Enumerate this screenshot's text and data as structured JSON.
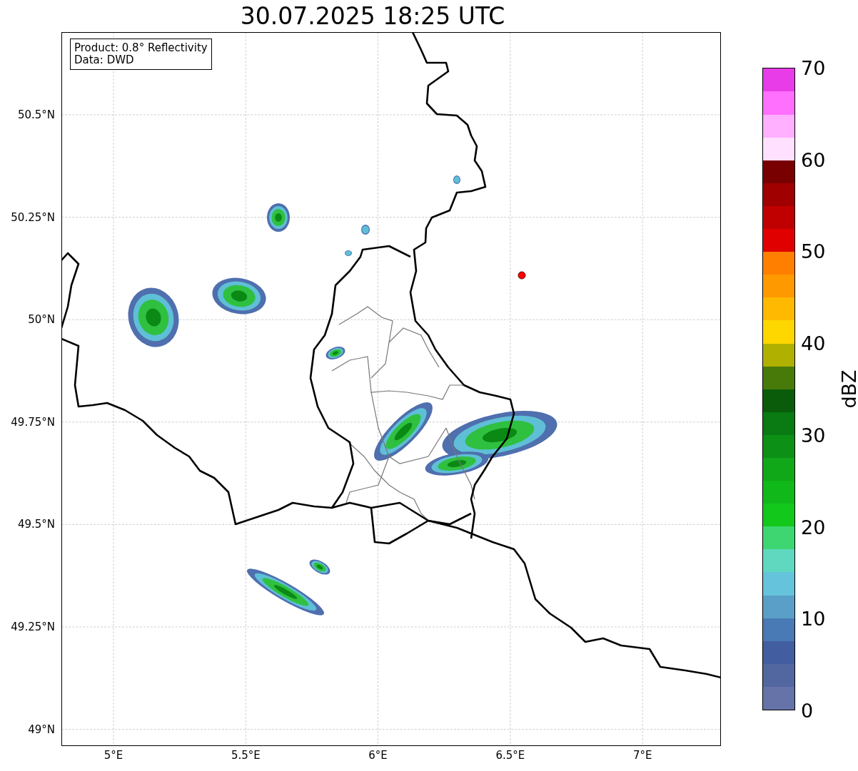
{
  "title": "30.07.2025 18:25 UTC",
  "legend": [
    "Product: 0.8° Reflectivity",
    "Data: DWD"
  ],
  "map": {
    "lat_ticks": [
      "50.5°N",
      "50.25°N",
      "50°N",
      "49.75°N",
      "49.5°N",
      "49.25°N",
      "49°N"
    ],
    "lon_ticks": [
      "5°E",
      "5.5°E",
      "6°E",
      "6.5°E",
      "7°E"
    ]
  },
  "colorbar": {
    "label": "dBZ",
    "ticks": [
      "70",
      "60",
      "50",
      "40",
      "30",
      "20",
      "10",
      "0"
    ],
    "bands": [
      {
        "color": "#6673a8"
      },
      {
        "color": "#5266a0"
      },
      {
        "color": "#425ea0"
      },
      {
        "color": "#4a7ab5"
      },
      {
        "color": "#5a9fc8"
      },
      {
        "color": "#65c3dc"
      },
      {
        "color": "#60d8c0"
      },
      {
        "color": "#3dd670"
      },
      {
        "color": "#12c81a"
      },
      {
        "color": "#10b81a"
      },
      {
        "color": "#10a818"
      },
      {
        "color": "#0c9015"
      },
      {
        "color": "#0a7a12"
      },
      {
        "color": "#0a5c0a"
      },
      {
        "color": "#487a0a"
      },
      {
        "color": "#b0b000"
      },
      {
        "color": "#ffd700"
      },
      {
        "color": "#ffb900"
      },
      {
        "color": "#ff9900"
      },
      {
        "color": "#ff7f00"
      },
      {
        "color": "#e00000"
      },
      {
        "color": "#c00000"
      },
      {
        "color": "#a00000"
      },
      {
        "color": "#780000"
      },
      {
        "color": "#ffe0ff"
      },
      {
        "color": "#ffb0ff"
      },
      {
        "color": "#ff70ff"
      },
      {
        "color": "#e83ce8"
      }
    ]
  }
}
